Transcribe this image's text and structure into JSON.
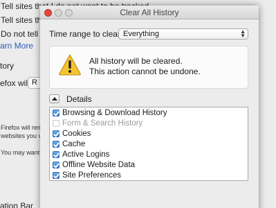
{
  "background": {
    "lines": [
      "Tell sites that I do not want to be tracked",
      "Tell sites tha",
      "Do not tell si",
      "arn More",
      "tory",
      "efox will:",
      "Firefox will rem",
      "websites you vi",
      "You may want t",
      "ation Bar"
    ],
    "field_value": "R"
  },
  "dialog": {
    "title": "Clear All History",
    "time_range_label": "Time range to clear:",
    "time_range_value": "Everything",
    "warning_line1": "All history will be cleared.",
    "warning_line2": "This action cannot be undone.",
    "details_label": "Details",
    "items": [
      {
        "label": "Browsing & Download History",
        "checked": true,
        "enabled": true
      },
      {
        "label": "Form & Search History",
        "checked": false,
        "enabled": false
      },
      {
        "label": "Cookies",
        "checked": true,
        "enabled": true
      },
      {
        "label": "Cache",
        "checked": true,
        "enabled": true
      },
      {
        "label": "Active Logins",
        "checked": true,
        "enabled": true
      },
      {
        "label": "Offline Website Data",
        "checked": true,
        "enabled": true
      },
      {
        "label": "Site Preferences",
        "checked": true,
        "enabled": true
      }
    ]
  },
  "icons": {
    "warning": "warning-triangle-icon",
    "details_toggle": "disclosure-triangle-icon"
  },
  "colors": {
    "close_button": "#e2463f",
    "checkbox_on": "#2a79d8",
    "warning_fill": "#f4c430",
    "link": "#2a5db0"
  }
}
